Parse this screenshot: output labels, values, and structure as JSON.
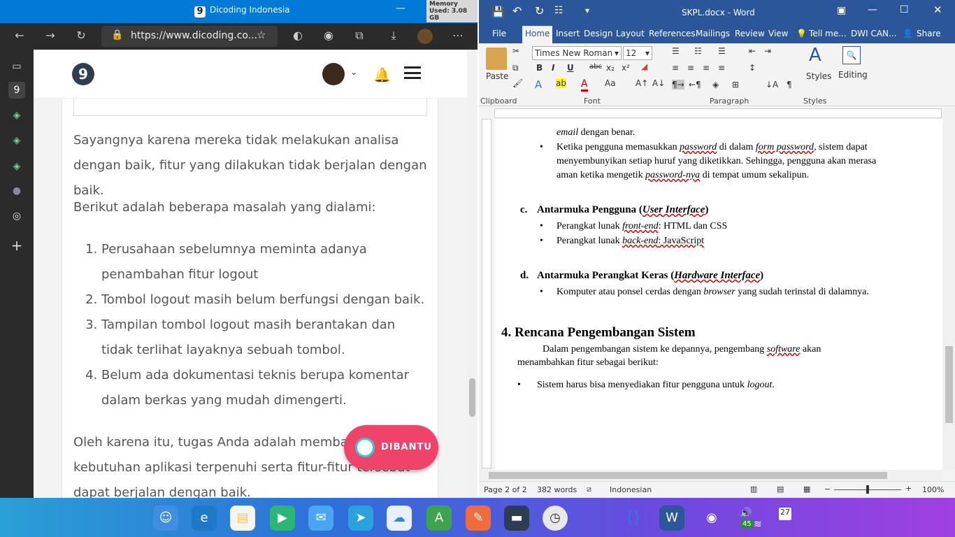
{
  "memory": "Memory Used: 3.08 GB",
  "browser": {
    "tab_title": "Dicoding Indonesia",
    "url": "https://www.dicoding.co...",
    "logo_letter": "9"
  },
  "article": {
    "p1": "Sayangnya karena mereka tidak melakukan analisa dengan baik, fitur yang dilakukan tidak berjalan dengan baik.",
    "p2": "Berikut adalah beberapa masalah yang dialami:",
    "list": [
      "Perusahaan sebelumnya meminta adanya penambahan fitur logout",
      "Tombol logout masih belum berfungsi dengan baik.",
      "Tampilan tombol logout masih berantakan dan tidak terlihat layaknya sebuah tombol.",
      "Belum ada dokumentasi teknis berupa komentar dalam berkas yang mudah dimengerti."
    ],
    "p3_l1": "Oleh karena itu, tugas Anda adalah membantu",
    "p3_l2": "kebutuhan aplikasi terpenuhi serta fitur-fitur tersebut",
    "p3_l3": "dapat berjalan dengan baik.",
    "badge": "DIBANTU"
  },
  "word": {
    "title": "SKPL.docx - Word",
    "tabs": [
      "File",
      "Home",
      "Insert",
      "Design",
      "Layout",
      "References",
      "Mailings",
      "Review",
      "View"
    ],
    "tellme": "Tell me...",
    "user": "DWI CAN...",
    "share": "Share",
    "font": "Times New Roman",
    "size": "12",
    "paste": "Paste",
    "styles": "Styles",
    "editing": "Editing",
    "groups": {
      "clipboard": "Clipboard",
      "font": "Font",
      "paragraph": "Paragraph",
      "styles": "Styles"
    },
    "status": {
      "page": "Page 2 of 2",
      "words": "382 words",
      "lang": "Indonesian",
      "zoom": "100%"
    }
  },
  "doc": {
    "l0a": "email",
    "l0b": " dengan benar.",
    "b1a": "Ketika pengguna memasukkan ",
    "b1b": "password",
    "b1c": " di dalam ",
    "b1d": "form password",
    "b1e": ", sistem dapat",
    "b1l2": "menyembunyikan setiap huruf yang diketikkan. Sehingga, pengguna akan merasa",
    "b1l3a": "aman ketika mengetik ",
    "b1l3b": "password-nya",
    "b1l3c": " di tempat umum sekalipun.",
    "hc_num": "c.",
    "hc_a": "Antarmuka Pengguna (",
    "hc_b": "User Interface",
    "hc_c": ")",
    "c1a": "Perangkat lunak ",
    "c1b": "front-end",
    "c1c": ": HTML dan CSS",
    "c2a": "Perangkat lunak ",
    "c2b": "back-end",
    "c2c": ": JavaScript",
    "hd_num": "d.",
    "hd_a": "Antarmuka Perangkat Keras (",
    "hd_b": "Hardware Interface",
    "hd_c": ")",
    "d1a": "Komputer atau ponsel cerdas dengan ",
    "d1b": "browser",
    "d1c": " yang sudah terinstal di dalamnya.",
    "h4": "4.  Rencana Pengembangan Sistem",
    "p4a": "Dalam pengembangan sistem ke depannya, pengembang ",
    "p4b": "software",
    "p4c": " akan",
    "p4l2": "menambahkan fitur sebagai berikut:",
    "s1a": "Sistem harus bisa menyediakan fitur pengguna untuk ",
    "s1b": "logout",
    "s1c": "."
  },
  "taskbar": {
    "lang_num": "45",
    "date": "27"
  }
}
